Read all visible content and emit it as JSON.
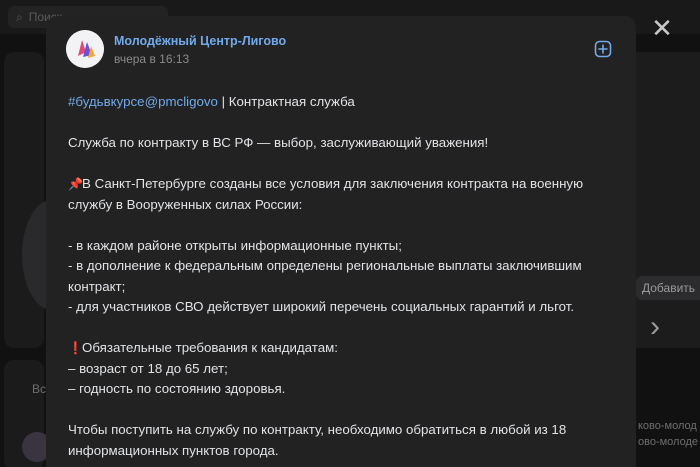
{
  "background": {
    "search_placeholder": "Поиск",
    "left_text": "Вс",
    "add_button_label": "Добавить",
    "right_text_1": "ково-молод",
    "right_text_2": "ово-молоде"
  },
  "post": {
    "author": "Молодёжный Центр-Лигово",
    "time": "вчера в 16:13",
    "hashtag": "#будьвкурсе@pmcligovo",
    "title_suffix": " | Контрактная служба",
    "intro": "Служба по контракту в ВС РФ — выбор, заслуживающий уважения!",
    "conditions_emoji": "📌",
    "conditions_line1": "В Санкт-Петербурге созданы все условия для заключения контракта на военную",
    "conditions_line2": "службу в Вооруженных силах России:",
    "bullets": [
      "- в каждом районе открыты информационные пункты;",
      "- в дополнение к федеральным определены региональные выплаты заключившим",
      "контракт;",
      "- для участников СВО действует широкий перечень социальных гарантий и льгот."
    ],
    "requirements_emoji": "❗",
    "requirements_title": "Обязательные требования к кандидатам:",
    "requirements": [
      "– возраст от 18 до 65 лет;",
      "– годность по состоянию здоровья."
    ],
    "closing_line1": "Чтобы поступить на службу по контракту, необходимо обратиться в любой из 18",
    "closing_line2": "информационных пунктов города."
  },
  "icons": {
    "close": "close-icon",
    "bookmark": "add-bookmark-icon",
    "search": "search-icon",
    "next": "chevron-right-icon"
  },
  "colors": {
    "link": "#71aaeb",
    "text": "#e1e3e6",
    "muted": "#8a8a8c",
    "modal_bg": "#222223"
  }
}
